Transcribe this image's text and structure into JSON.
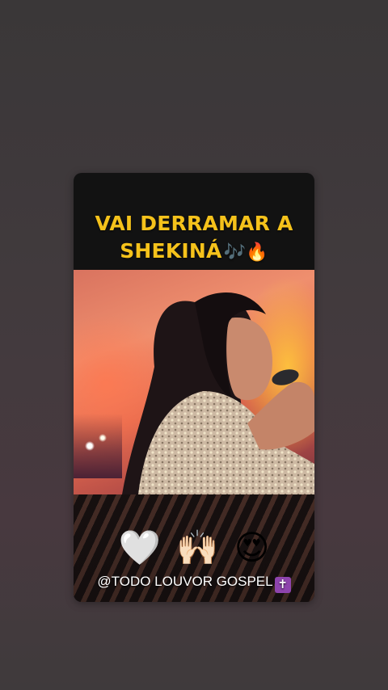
{
  "story": {
    "title_line1": "VAI DERRAMAR A",
    "title_line2": "SHEKINÁ",
    "title_emojis": "🎶🔥",
    "reaction_emojis": [
      "🤍",
      "🙌🏻",
      "😍"
    ],
    "handle": "@TODO LOUVOR GOSPEL",
    "handle_emoji": "✝"
  },
  "colors": {
    "title": "#f5c21b",
    "background": "#413a3d",
    "card": "#121212"
  }
}
